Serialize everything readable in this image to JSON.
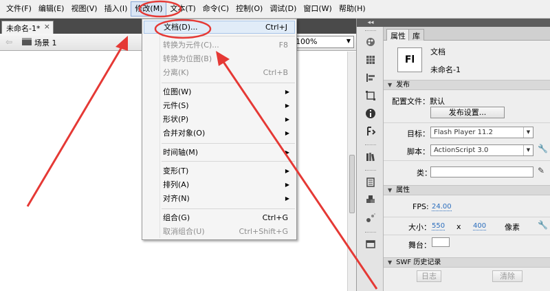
{
  "menubar": {
    "items": [
      "文件(F)",
      "编辑(E)",
      "视图(V)",
      "插入(I)",
      "修改(M)",
      "文本(T)",
      "命令(C)",
      "控制(O)",
      "调试(D)",
      "窗口(W)",
      "帮助(H)"
    ]
  },
  "document": {
    "tab_label": "未命名-1*",
    "tab_close": "×",
    "scene_label": "场景 1",
    "zoom": "100%"
  },
  "modify_menu": {
    "items": [
      {
        "label": "文档(D)...",
        "shortcut": "Ctrl+J"
      },
      {
        "label": "转换为元件(C)...",
        "shortcut": "F8"
      },
      {
        "label": "转换为位图(B)",
        "shortcut": ""
      },
      {
        "label": "分离(K)",
        "shortcut": "Ctrl+B"
      },
      {
        "label": "位图(W)",
        "shortcut": ""
      },
      {
        "label": "元件(S)",
        "shortcut": ""
      },
      {
        "label": "形状(P)",
        "shortcut": ""
      },
      {
        "label": "合并对象(O)",
        "shortcut": ""
      },
      {
        "label": "时间轴(M)",
        "shortcut": ""
      },
      {
        "label": "变形(T)",
        "shortcut": ""
      },
      {
        "label": "排列(A)",
        "shortcut": ""
      },
      {
        "label": "对齐(N)",
        "shortcut": ""
      },
      {
        "label": "组合(G)",
        "shortcut": "Ctrl+G"
      },
      {
        "label": "取消组合(U)",
        "shortcut": "Ctrl+Shift+G"
      }
    ]
  },
  "properties": {
    "tabs": [
      "属性",
      "库"
    ],
    "fl_icon": "Fl",
    "doc_type": "文档",
    "doc_name": "未命名-1",
    "publish": {
      "section": "发布",
      "profile_label": "配置文件：默认",
      "settings_button": "发布设置...",
      "target_label": "目标：",
      "target_value": "Flash Player 11.2",
      "script_label": "脚本：",
      "script_value": "ActionScript 3.0",
      "class_label": "类："
    },
    "props": {
      "section": "属性",
      "fps_label": "FPS:",
      "fps_value": "24.00",
      "size_label": "大小：",
      "width": "550",
      "x": "x",
      "height": "400",
      "unit": "像素",
      "stage_label": "舞台："
    },
    "swf_history": {
      "section": "SWF 历史记录",
      "log_button": "日志",
      "clear_button": "清除"
    }
  },
  "colors": {
    "annotation": "#e53935",
    "link": "#2a6dbd",
    "stage_color": "#ffffff"
  }
}
